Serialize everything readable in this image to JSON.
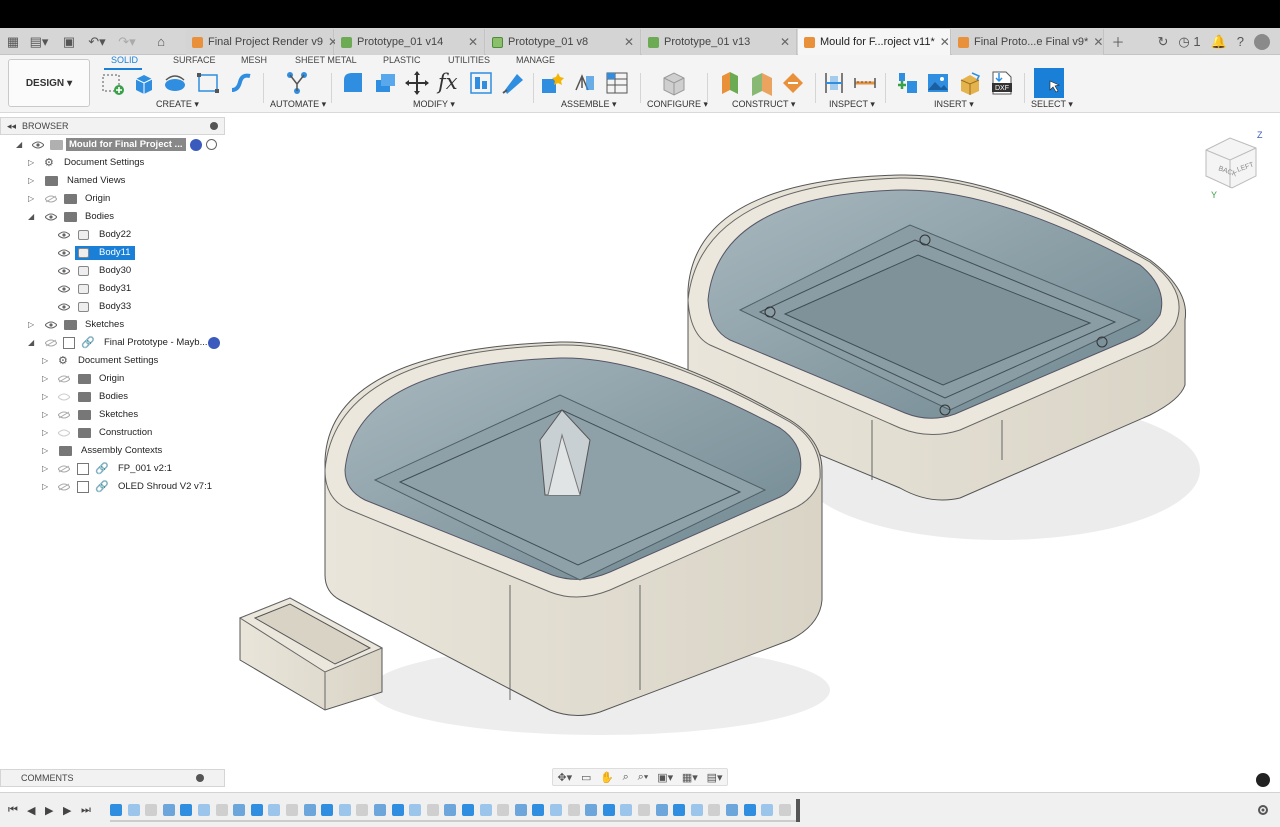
{
  "tabs": [
    {
      "label": "Final Project Render v9",
      "icon": "orange"
    },
    {
      "label": "Prototype_01 v14",
      "icon": "green"
    },
    {
      "label": "Prototype_01 v8",
      "icon": "green2"
    },
    {
      "label": "Prototype_01 v13",
      "icon": "green"
    },
    {
      "label": "Mould for F...roject v11*",
      "icon": "orange",
      "active": true
    },
    {
      "label": "Final Proto...e Final v9*",
      "icon": "orange"
    }
  ],
  "notifications_count": "1",
  "toolbar": {
    "design_label": "DESIGN",
    "workspace_tabs": [
      "SOLID",
      "SURFACE",
      "MESH",
      "SHEET METAL",
      "PLASTIC",
      "UTILITIES",
      "MANAGE"
    ],
    "groups": [
      "CREATE",
      "AUTOMATE",
      "MODIFY",
      "ASSEMBLE",
      "CONFIGURE",
      "CONSTRUCT",
      "INSPECT",
      "INSERT",
      "SELECT"
    ],
    "accent": "#1a7fd6"
  },
  "browser": {
    "title": "BROWSER",
    "root": "Mould for Final Project ...",
    "items": {
      "doc_settings": "Document Settings",
      "named_views": "Named Views",
      "origin": "Origin",
      "bodies": "Bodies",
      "body22": "Body22",
      "body11": "Body11",
      "body30": "Body30",
      "body31": "Body31",
      "body33": "Body33",
      "sketches": "Sketches",
      "final_proto": "Final Prototype - Mayb...",
      "sub_doc_settings": "Document Settings",
      "sub_origin": "Origin",
      "sub_bodies": "Bodies",
      "sub_sketches": "Sketches",
      "sub_construction": "Construction",
      "assembly_contexts": "Assembly Contexts",
      "fp001": "FP_001 v2:1",
      "oled": "OLED Shroud V2 v7:1"
    }
  },
  "viewcube": {
    "back": "BACK",
    "left": "LEFT",
    "z": "Z",
    "y": "Y"
  },
  "comments": "COMMENTS"
}
